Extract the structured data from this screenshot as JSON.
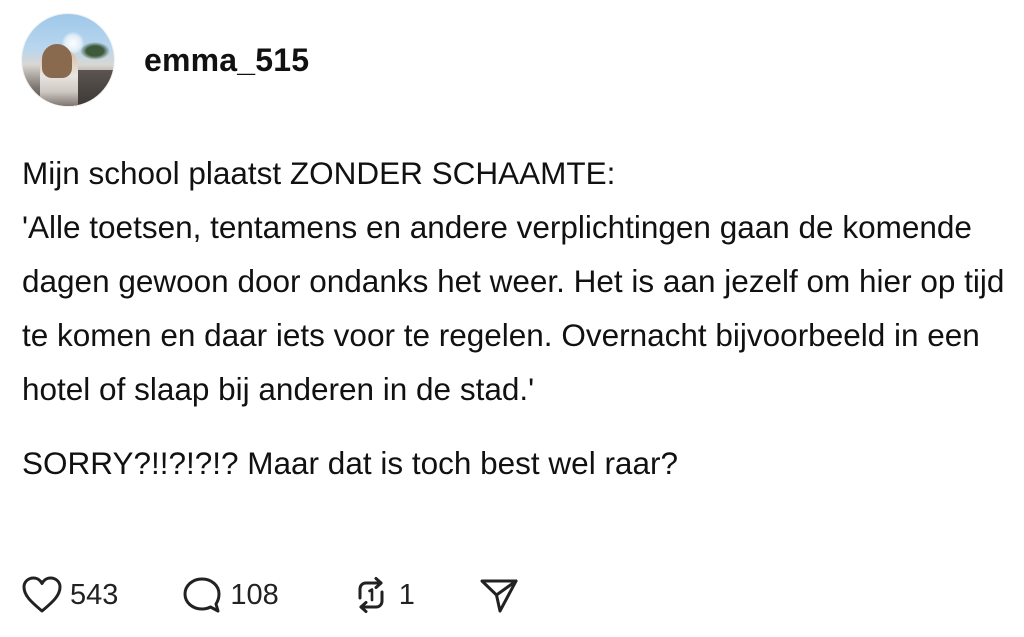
{
  "post": {
    "username": "emma_515",
    "paragraphs": [
      "Mijn school plaatst ZONDER SCHAAMTE:",
      "'Alle toetsen, tentamens en andere verplichtingen gaan de komende dagen gewoon door ondanks het weer. Het is aan jezelf om hier op tijd te komen en daar iets voor te regelen. Overnacht bijvoorbeeld in een hotel of slaap bij anderen in de stad.'",
      "SORRY?!!?!?!? Maar dat is toch best wel raar?"
    ],
    "actions": {
      "likes": "543",
      "replies": "108",
      "reposts": "1",
      "like_icon": "heart-icon",
      "reply_icon": "speech-bubble-icon",
      "repost_icon": "repost-icon",
      "share_icon": "send-icon"
    }
  },
  "colors": {
    "text": "#111111",
    "icon": "#222222",
    "background": "#ffffff"
  }
}
